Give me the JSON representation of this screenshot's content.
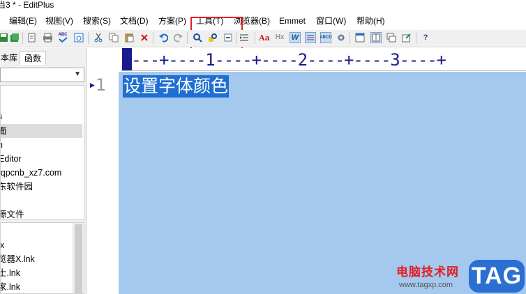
{
  "window": {
    "title": "当3 * - EditPlus"
  },
  "menu": [
    {
      "label": "编辑(E)"
    },
    {
      "label": "视图(V)"
    },
    {
      "label": "搜索(S)"
    },
    {
      "label": "文档(D)"
    },
    {
      "label": "方案(P)"
    },
    {
      "label": "工具(T)"
    },
    {
      "label": "浏览器(B)"
    },
    {
      "label": "Emmet"
    },
    {
      "label": "窗口(W)"
    },
    {
      "label": "帮助(H)"
    }
  ],
  "toolbar": {
    "icons": [
      "save-icon",
      "save-all-icon",
      "print-preview-icon",
      "print-icon",
      "spell-check-icon",
      "browser-preview-icon",
      "cut-icon",
      "copy-icon",
      "paste-icon",
      "delete-icon",
      "undo-icon",
      "redo-icon",
      "find-icon",
      "replace-icon",
      "go-to-icon",
      "indent-icon",
      "font-icon",
      "hex-icon",
      "word-wrap-icon",
      "ruler-icon",
      "line-number-icon",
      "format-icon",
      "settings-icon",
      "window-list-icon",
      "tile-icon",
      "cascade-icon",
      "restore-icon",
      "help-icon"
    ],
    "glyphs": {
      "spell": "ABC",
      "font": "Aa",
      "hex": "Hx",
      "wrap": "W",
      "abc_cd": "ABCD",
      "help": "?"
    }
  },
  "sidebar": {
    "tabs": [
      {
        "label": "本库"
      },
      {
        "label": "函数"
      }
    ],
    "files": [
      {
        "label": "s"
      },
      {
        "label": "面"
      },
      {
        "label": "n"
      },
      {
        "label": "Editor"
      },
      {
        "label": "lqpcnb_xz7.com"
      },
      {
        "label": "东软件园"
      },
      {
        "label": ""
      },
      {
        "label": "源文件"
      }
    ],
    "links": [
      {
        "label": "x"
      },
      {
        "label": "览器X.lnk"
      },
      {
        "label": "士.lnk"
      },
      {
        "label": "家.lnk"
      }
    ]
  },
  "editor": {
    "ruler": "----+----1----+----2----+----3----+",
    "line_number": "1",
    "selected_text": "设置字体颜色",
    "selection_color": "#1f6fd1",
    "background_color": "#a4c8ee"
  },
  "watermark": {
    "main": "电脑技术网",
    "url": "www.tagxp.com",
    "tag": "TAG"
  }
}
